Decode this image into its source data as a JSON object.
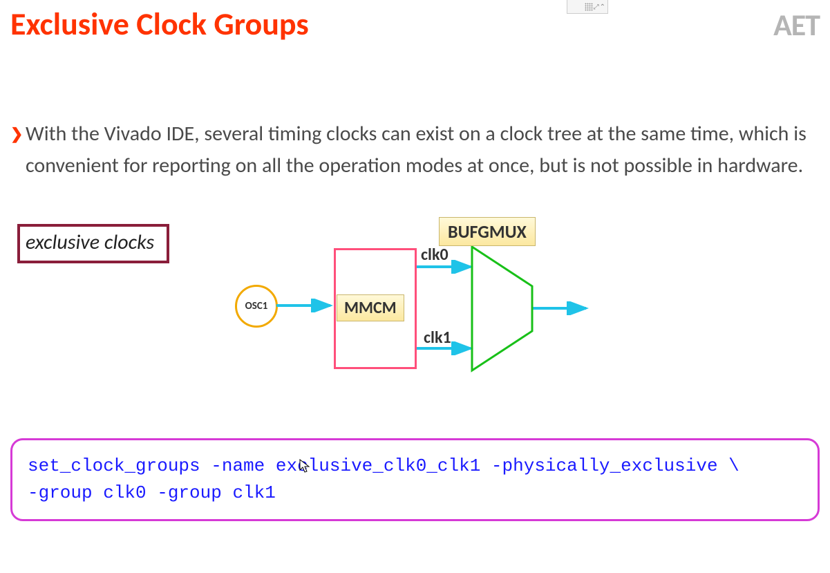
{
  "header": {
    "title": "Exclusive Clock Groups",
    "logo": "AET"
  },
  "bullet_text": "With the Vivado IDE, several timing clocks can exist on a clock tree at the same time, which is convenient for reporting on all the operation modes at once, but is not possible in hardware.",
  "diagram": {
    "excl_label": "exclusive clocks",
    "osc": "OSC1",
    "mmcm": "MMCM",
    "bufg": "BUFGMUX",
    "clk0": "clk0",
    "clk1": "clk1"
  },
  "code": "set_clock_groups -name exclusive_clk0_clk1 -physically_exclusive \\\n-group clk0 -group clk1"
}
